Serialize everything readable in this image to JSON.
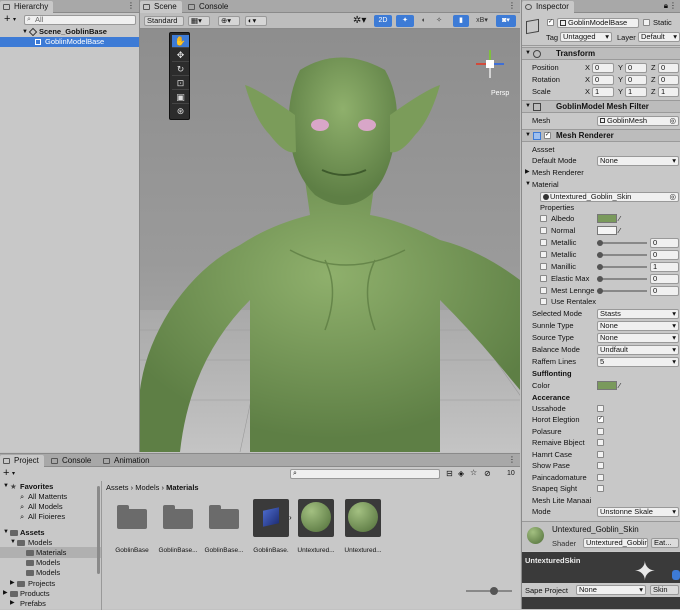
{
  "hierarchy": {
    "tab": "Hierarchy",
    "search_placeholder": "All",
    "add_label": "+",
    "scene_name": "Scene_GoblinBase",
    "object_name": "GoblinModelBase"
  },
  "scene": {
    "tabs": [
      "Scene",
      "Console"
    ],
    "shading_mode": "Standard",
    "toggles": [
      "2D",
      "Light",
      "Audio",
      "FX",
      "Gizmos"
    ],
    "gizmos_label": "xB",
    "persp_label": "Persp"
  },
  "inspector": {
    "tab": "Inspector",
    "object_name": "GoblinModelBase",
    "static_label": "Static",
    "tag_label": "Tag",
    "tag_value": "Untagged",
    "layer_label": "Layer",
    "layer_value": "Default",
    "transform": {
      "title": "Transform",
      "rows": [
        {
          "label": "Position",
          "x": "0",
          "y": "0",
          "z": "0"
        },
        {
          "label": "Rotation",
          "x": "0",
          "y": "0",
          "z": "0"
        },
        {
          "label": "Scale",
          "x": "1",
          "y": "1",
          "z": "1"
        }
      ]
    },
    "mesh_filter": {
      "title": "GoblinModel Mesh Filter",
      "mesh_label": "Mesh",
      "mesh_value": "GoblinMesh"
    },
    "mesh_renderer": {
      "title": "Mesh Renderer",
      "asset_label": "Assset",
      "default_mode_label": "Default Mode",
      "default_mode_value": "None",
      "mesh_renderer_label": "Mesh Renderer",
      "material_label": "Material",
      "material_value": "Untextured_Goblin_Skin",
      "properties_label": "Properties",
      "albedo": "Albedo",
      "normal": "Normal",
      "metallic1": "Metallic",
      "metallic1_value": "0",
      "metallic2": "Metallic",
      "metallic2_value": "0",
      "manillic": "Manillic",
      "manillic_value": "1",
      "elastic": "Elastic Max",
      "elastic_value": "0",
      "mest": "Mest Lennge",
      "mest_value": "0",
      "use_rentalex": "Use Rentalex",
      "selected_mode_label": "Selected Mode",
      "selected_mode_value": "Stasts",
      "sunnle_label": "Sunnle Type",
      "sunnle_value": "None",
      "source_label": "Source Type",
      "source_value": "None",
      "balance_label": "Balance Mode",
      "balance_value": "Undfault",
      "raffem_label": "Raffem Lines",
      "raffem_value": "5",
      "sufflonting_label": "Sufflonting",
      "color_label": "Color",
      "accerance_label": "Accerance",
      "toggles": [
        "Ussahode",
        "Horot Elegtion",
        "Polasure",
        "Remaive Bbject",
        "Hamrt Case",
        "Show Pase",
        "Paincadomature",
        "Snapeq Sight"
      ],
      "mesh_lite_label": "Mesh Lite Manaai",
      "mode_label": "Mode",
      "mode_value": "Unstonne Skale"
    },
    "material_footer": {
      "name": "Untextured_Goblin_Skin",
      "shader_label": "Shader",
      "shader_value": "Untextured_Goblin...",
      "edit_label": "Eat..."
    },
    "preview": {
      "title": "UntexturedSkin",
      "sape_label": "Sape Project",
      "sape_value": "None",
      "skin_label": "Skin"
    }
  },
  "project": {
    "tabs": [
      "Project",
      "Console",
      "Animation"
    ],
    "add_label": "+",
    "count": "10",
    "favorites": {
      "title": "Favorites",
      "items": [
        "All Mattents",
        "All Models",
        "All Fioieres"
      ]
    },
    "assets": {
      "title": "Assets",
      "models": "Models",
      "materials": "Materials",
      "models_a": "Models",
      "models_b": "Models",
      "projects": "Projects",
      "products": "Products",
      "prefabs": "Prefabs"
    },
    "breadcrumb": [
      "Assets",
      "Models",
      "Materials"
    ],
    "grid": [
      "GoblinBase",
      "GoblinBase...",
      "GoblinBase...",
      "GoblinBase.",
      "Untextured...",
      "Untextured..."
    ]
  },
  "colors": {
    "accent": "#3d7bd6",
    "goblin_skin": "#7a9a5c",
    "panel": "#c8c8c8"
  }
}
